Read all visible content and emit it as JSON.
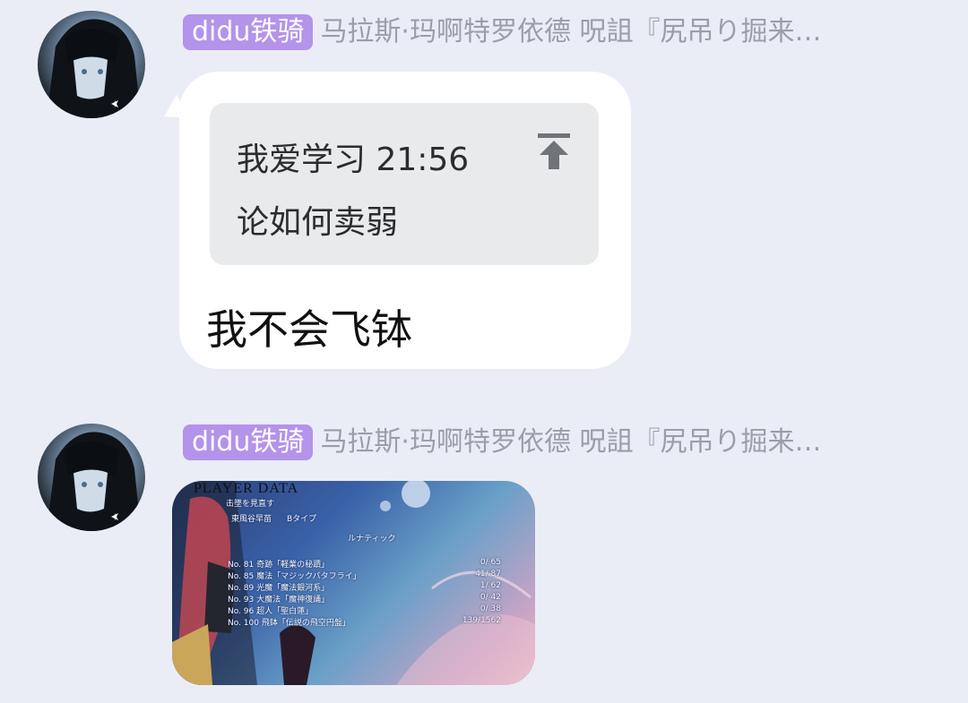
{
  "messages": [
    {
      "tag": "didu铁骑",
      "title": "马拉斯·玛啊特罗依德 呪詛『尻吊り掘来…",
      "quote": {
        "author_time": "我爱学习 21:56",
        "text": "论如何卖弱"
      },
      "text": "我不会飞钵"
    },
    {
      "tag": "didu铁骑",
      "title": "马拉斯·玛啊特罗依德 呪詛『尻吊り掘来…",
      "image": {
        "header": "PLAYER DATA",
        "subheader": "击墜を見直す",
        "mode_left": "東風谷早苗",
        "mode_right": "Bタイプ",
        "level": "ルナティック",
        "rows": [
          {
            "label": "No. 81 奇跡「軽業の秘蹟」",
            "score": "0/ 65"
          },
          {
            "label": "No. 85 魔法「マジックバタフライ」",
            "score": "41/ 87"
          },
          {
            "label": "No. 89 光魔「魔法銀河系」",
            "score": "1/ 62"
          },
          {
            "label": "No. 93 大魔法「魔神復誦」",
            "score": "0/ 42"
          },
          {
            "label": "No. 96 超人「聖白蓮」",
            "score": "0/ 38"
          },
          {
            "label": "No. 100 飛鉢「伝説の飛空円盤」",
            "score": "139/1562"
          }
        ]
      }
    }
  ],
  "colors": {
    "background": "#eaedf6",
    "tag": "#b493ea",
    "title": "#9a9ea8",
    "bubble": "#ffffff",
    "quote_bg": "#e9eaec"
  },
  "icons": {
    "quote_jump": "jump-to-top-icon"
  }
}
